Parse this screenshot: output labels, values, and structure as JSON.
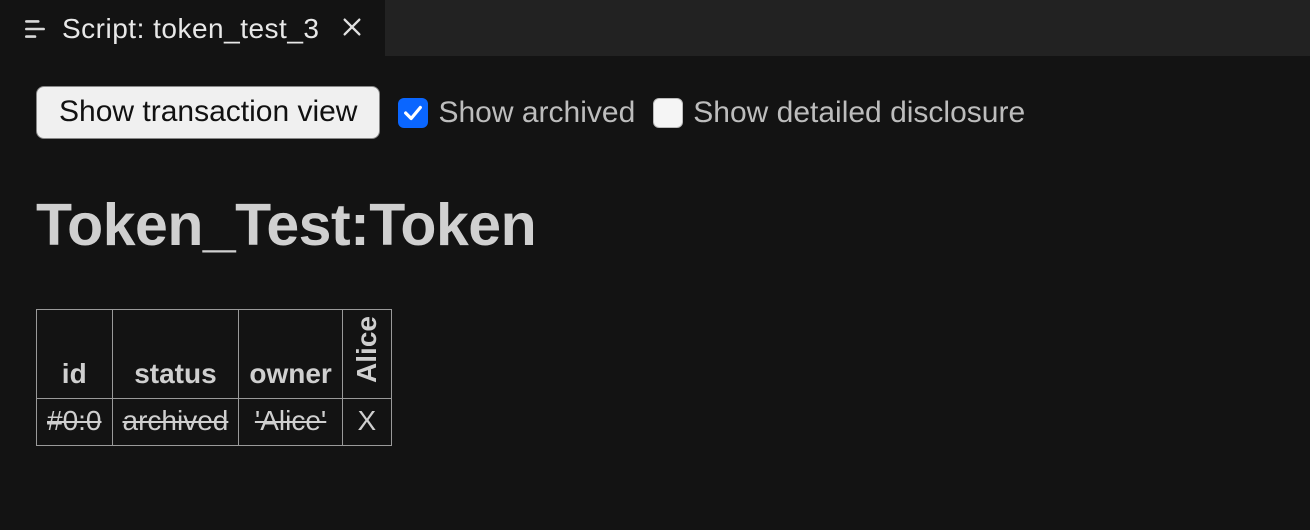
{
  "tab": {
    "title": "Script: token_test_3"
  },
  "controls": {
    "transaction_button": "Show transaction view",
    "archived": {
      "label": "Show archived",
      "checked": true
    },
    "detailed": {
      "label": "Show detailed disclosure",
      "checked": false
    }
  },
  "heading": "Token_Test:Token",
  "table": {
    "headers": {
      "id": "id",
      "status": "status",
      "owner": "owner",
      "party0": "Alice"
    },
    "rows": [
      {
        "id": "#0:0",
        "status": "archived",
        "owner": "'Alice'",
        "party0": "X",
        "archived": true
      }
    ]
  }
}
